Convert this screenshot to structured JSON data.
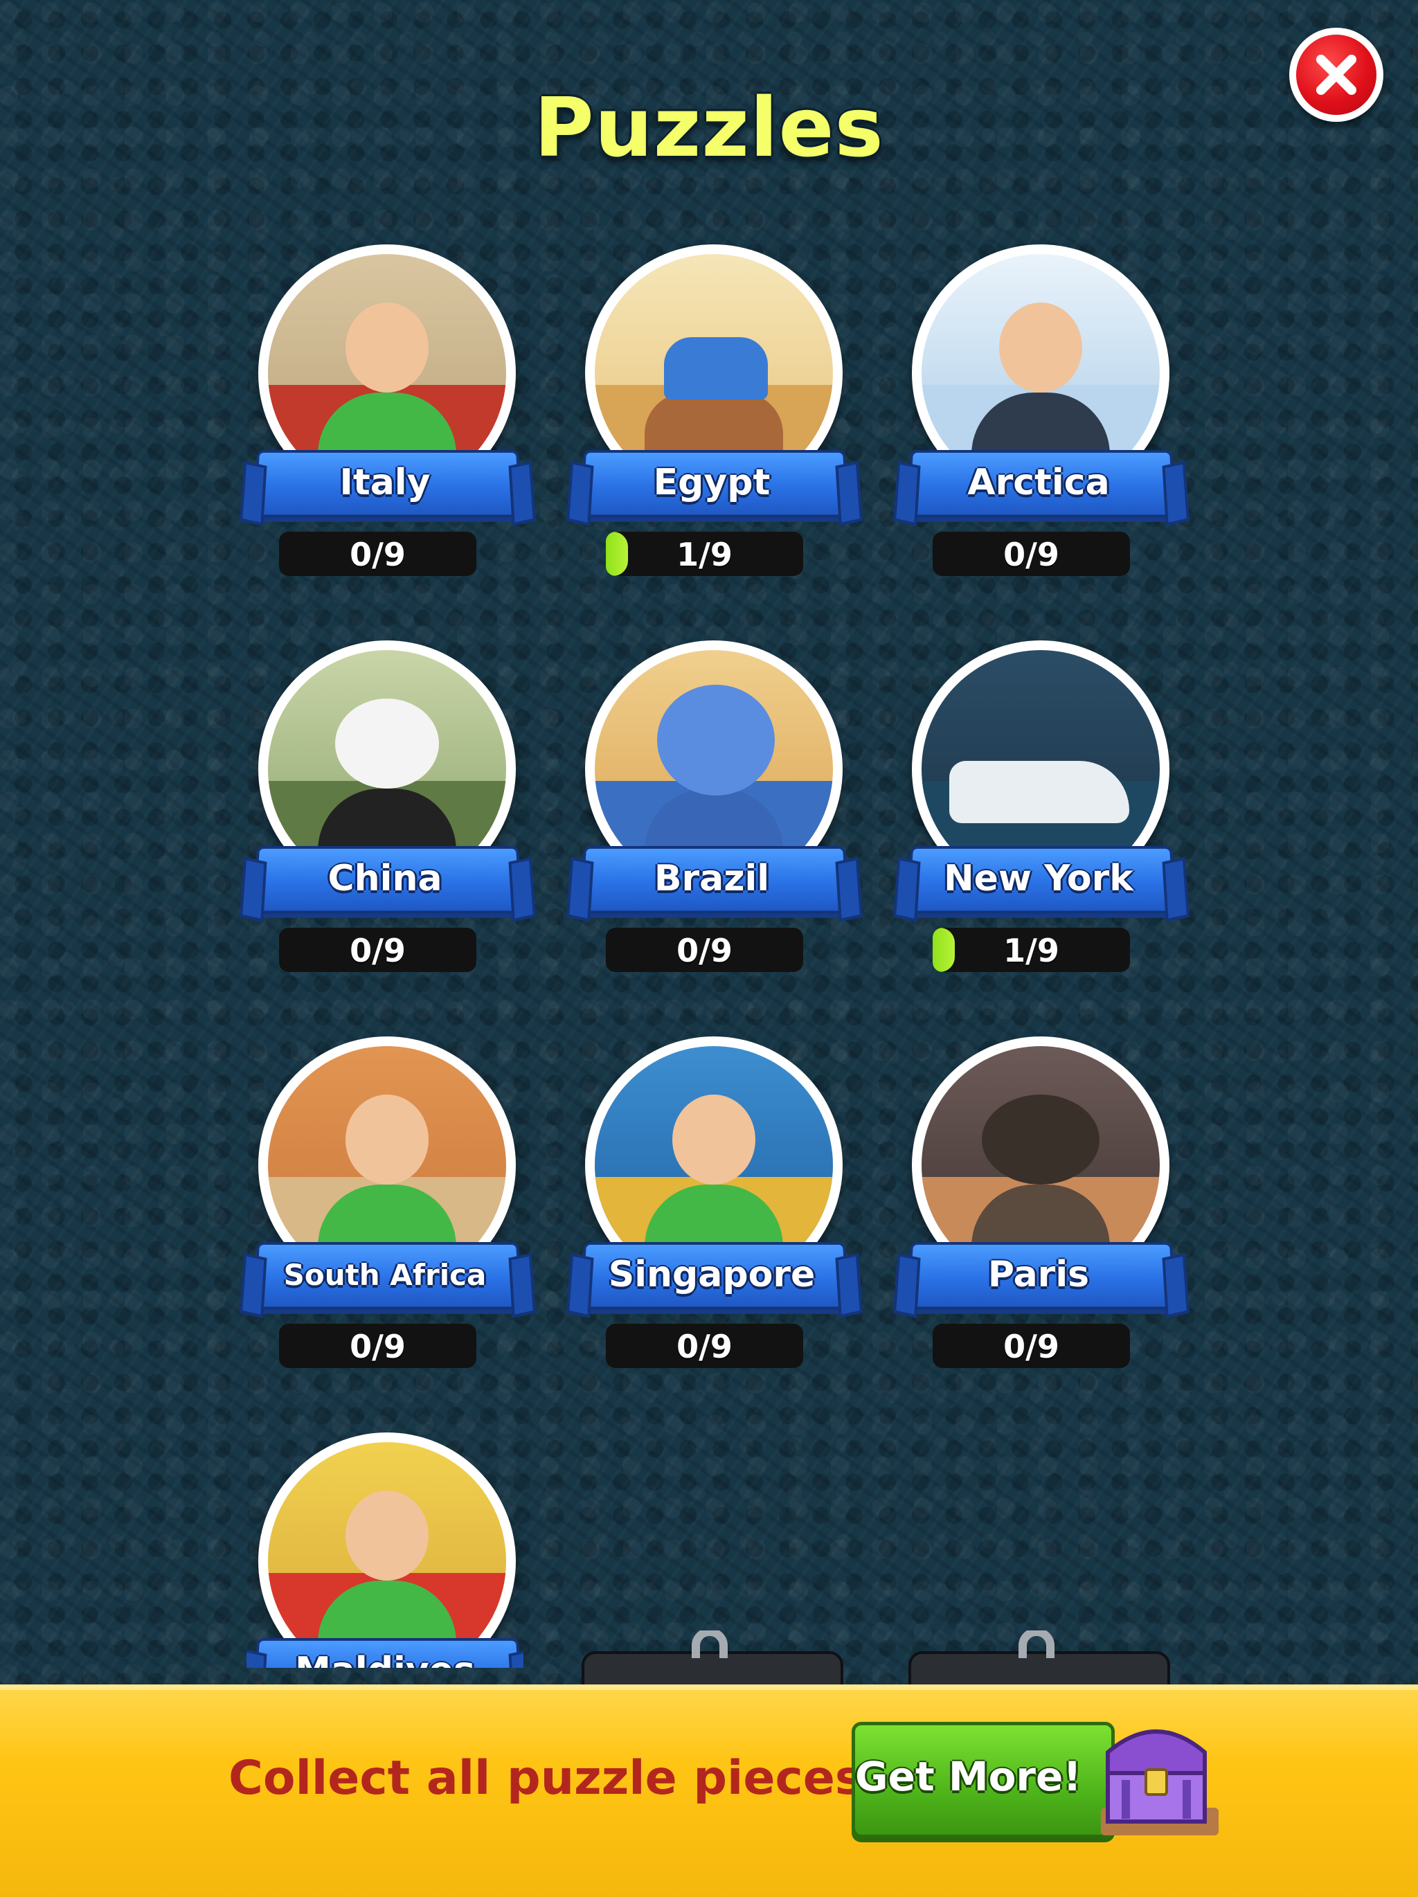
{
  "title": "Puzzles",
  "close_icon": "close-x-icon",
  "colors": {
    "background": "#173646",
    "title": "#f4ff6a",
    "banner": "#2a72e6",
    "progress_fill": "#9be824",
    "footer": "#ffc514",
    "footer_text": "#b3261e",
    "button_green": "#4fb51b",
    "close_red": "#e0101a"
  },
  "puzzles": [
    {
      "name": "Italy",
      "progress_text": "0/9",
      "collected": 0,
      "total": 9
    },
    {
      "name": "Egypt",
      "progress_text": "1/9",
      "collected": 1,
      "total": 9
    },
    {
      "name": "Arctica",
      "progress_text": "0/9",
      "collected": 0,
      "total": 9
    },
    {
      "name": "China",
      "progress_text": "0/9",
      "collected": 0,
      "total": 9
    },
    {
      "name": "Brazil",
      "progress_text": "0/9",
      "collected": 0,
      "total": 9
    },
    {
      "name": "New York",
      "progress_text": "1/9",
      "collected": 1,
      "total": 9
    },
    {
      "name": "South Africa",
      "progress_text": "0/9",
      "collected": 0,
      "total": 9
    },
    {
      "name": "Singapore",
      "progress_text": "0/9",
      "collected": 0,
      "total": 9
    },
    {
      "name": "Paris",
      "progress_text": "0/9",
      "collected": 0,
      "total": 9
    },
    {
      "name": "Maldives"
    }
  ],
  "locked_slots": [
    {
      "icon": "padlock-icon"
    },
    {
      "icon": "padlock-icon"
    }
  ],
  "footer": {
    "message": "Collect all puzzle pieces!",
    "button_label": "Get More!",
    "chest_icon": "treasure-chest-icon"
  }
}
